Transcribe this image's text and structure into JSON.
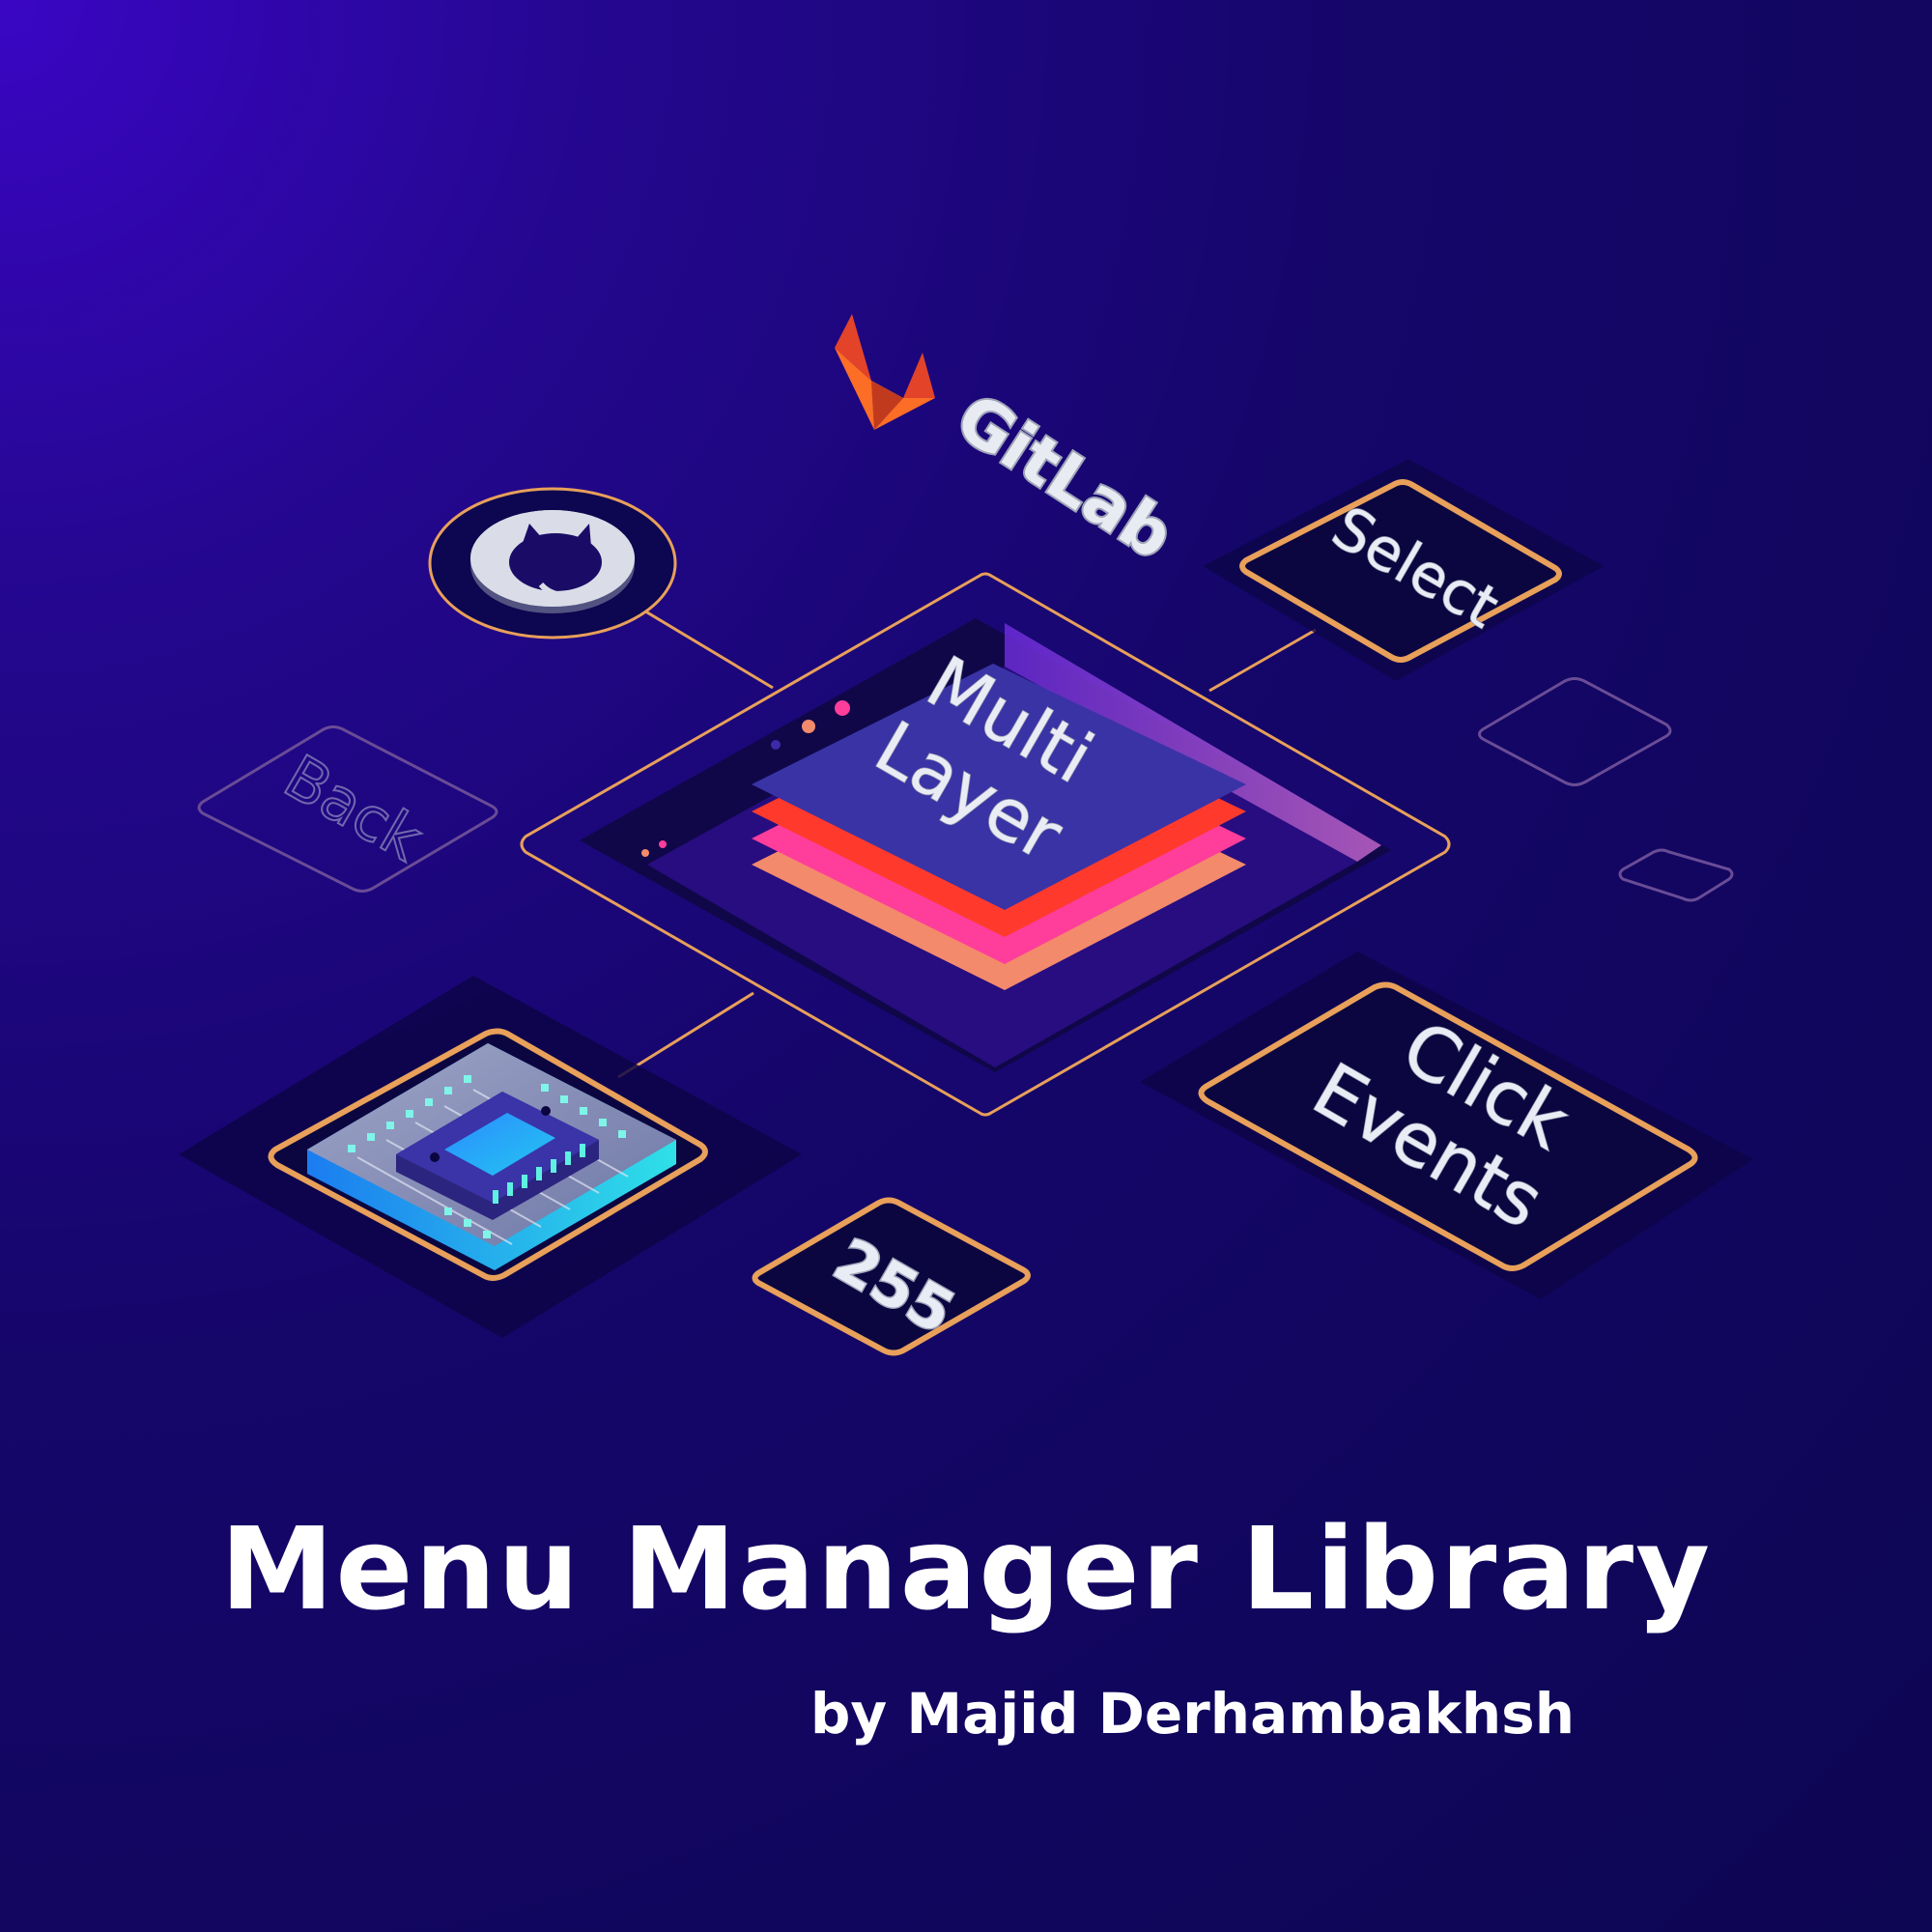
{
  "title": "Menu Manager Library",
  "subtitle": "by Majid Derhambakhsh",
  "tiles": {
    "select": "Select",
    "back": "Back",
    "center_line1": "Multi",
    "center_line2": "Layer",
    "click_line1": "Click",
    "click_line2": "Events",
    "number": "255"
  },
  "logos": {
    "gitlab_text": "GitLab",
    "gitlab_icon": "gitlab-fox-icon",
    "github_icon": "github-octocat-icon",
    "chip_icon": "microcontroller-chip-icon"
  },
  "colors": {
    "accent_orange": "#e8a05a",
    "layer_red": "#ff3a2c",
    "layer_pink": "#ff3d9a",
    "layer_peach": "#f38a6b",
    "top_layer": "#3a33a6"
  }
}
